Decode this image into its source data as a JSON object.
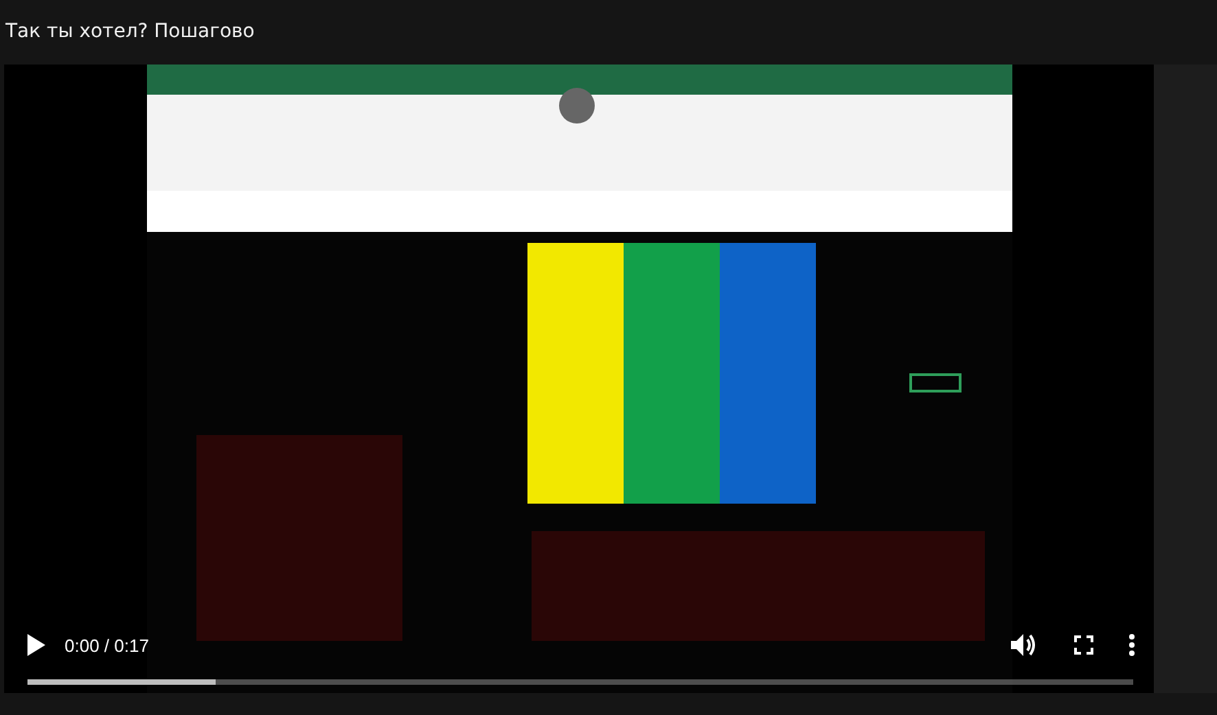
{
  "title": "Так ты хотел? Пошагово",
  "video": {
    "kind": "picture",
    "time": "0:00 / 0:17",
    "playing": false,
    "buffered": {
      "level": 0.17
    }
  }
}
